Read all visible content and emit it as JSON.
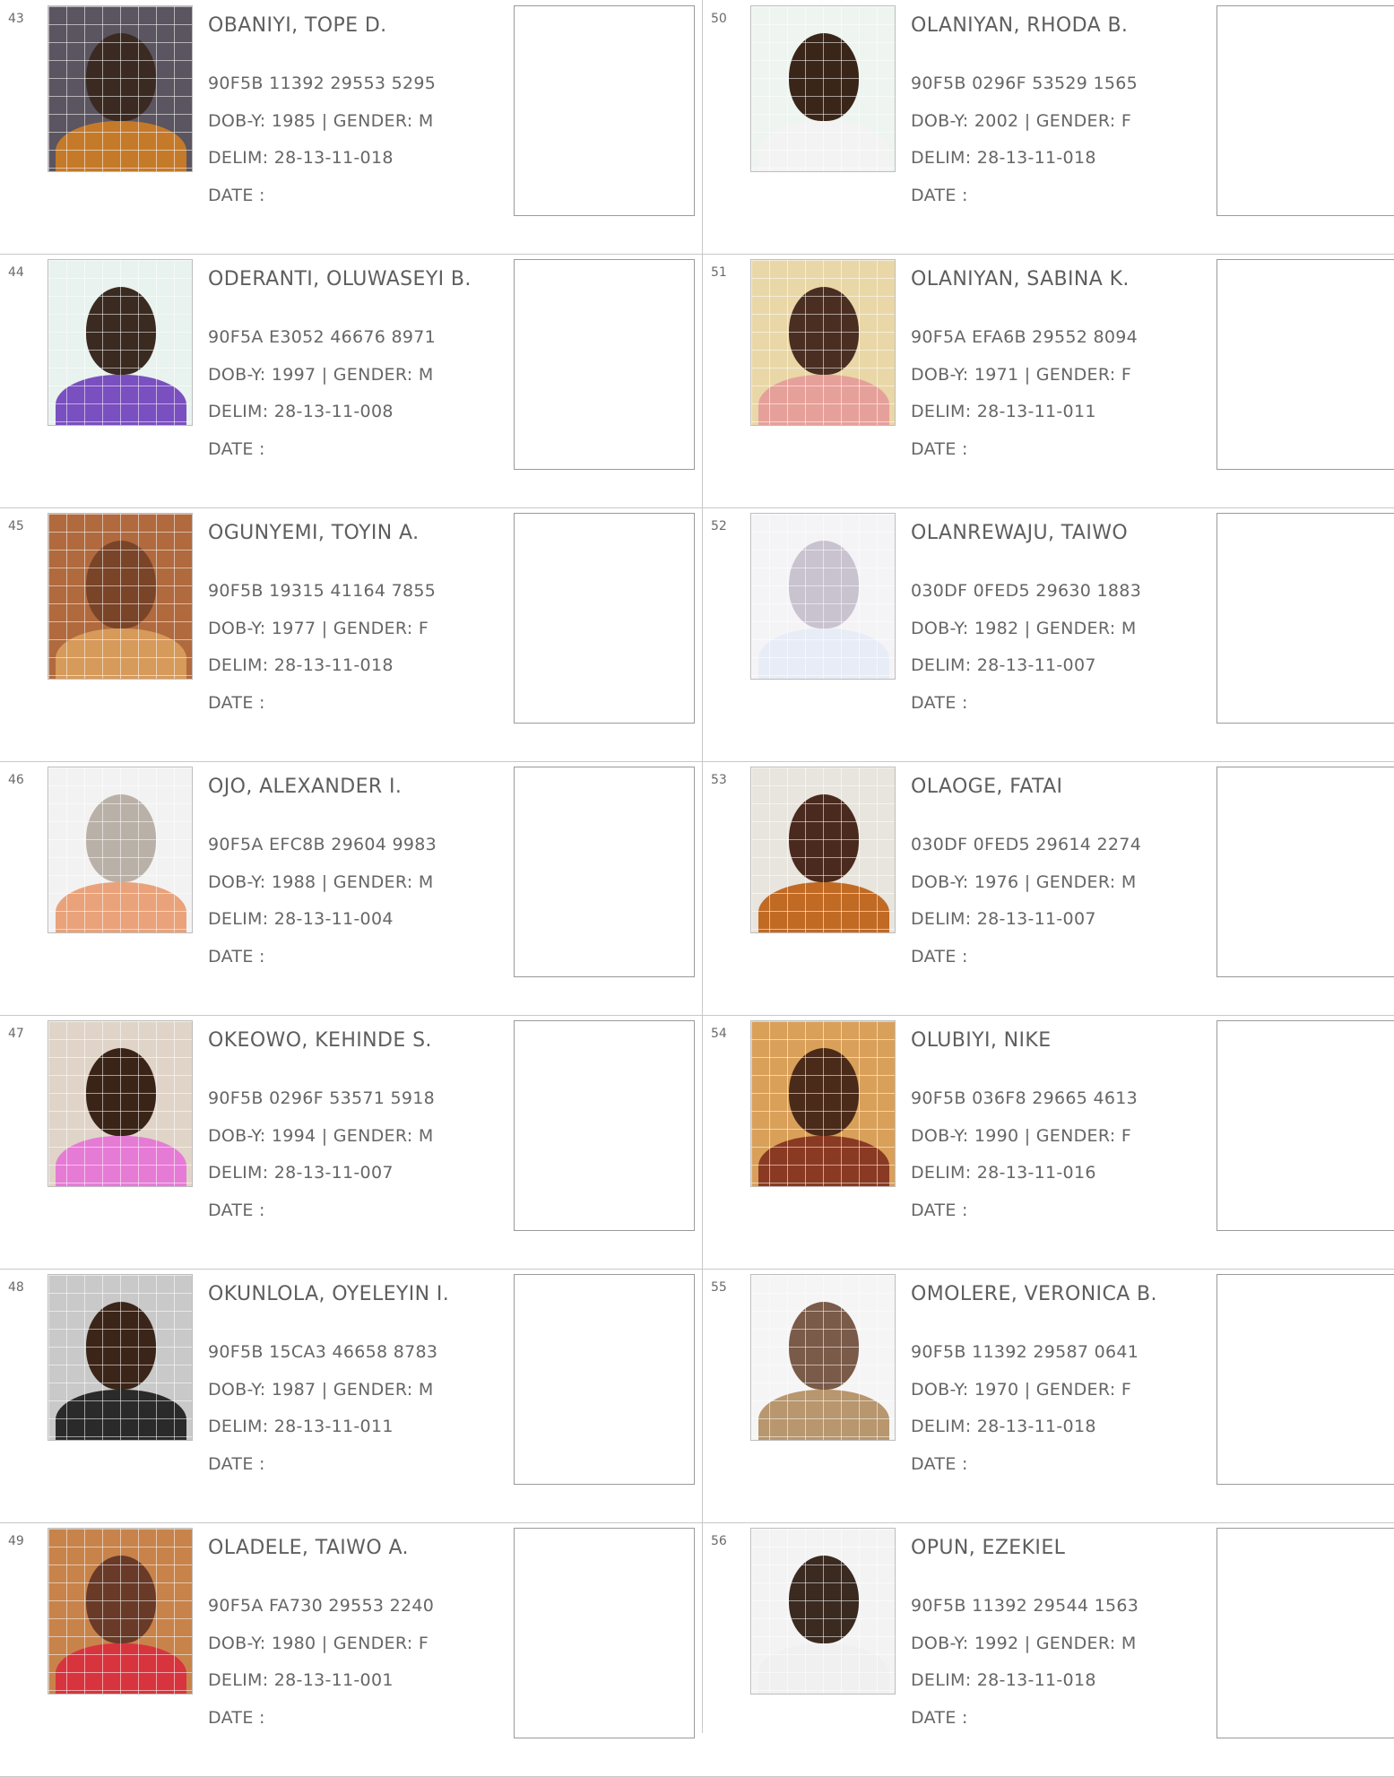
{
  "records": [
    {
      "serial": "43",
      "name": "OBANIYI, TOPE D.",
      "vin": "90F5B 11392 29553 5295",
      "dob_gender": "DOB-Y: 1985  | GENDER: M",
      "delim": "DELIM: 28-13-11-018",
      "date": "DATE  :",
      "photo": {
        "bg": "#5a5560",
        "head": "#3b2a22",
        "body": "#c57a2a"
      }
    },
    {
      "serial": "44",
      "name": "ODERANTI, OLUWASEYI B.",
      "vin": "90F5A E3052 46676 8971",
      "dob_gender": "DOB-Y: 1997  | GENDER: M",
      "delim": "DELIM: 28-13-11-008",
      "date": "DATE  :",
      "photo": {
        "bg": "#e8f2ee",
        "head": "#3a2a20",
        "body": "#7a4fbf"
      }
    },
    {
      "serial": "45",
      "name": "OGUNYEMI, TOYIN A.",
      "vin": "90F5B 19315 41164 7855",
      "dob_gender": "DOB-Y: 1977  | GENDER: F",
      "delim": "DELIM: 28-13-11-018",
      "date": "DATE  :",
      "photo": {
        "bg": "#b06a3e",
        "head": "#7a4428",
        "body": "#d69a5a"
      }
    },
    {
      "serial": "46",
      "name": "OJO, ALEXANDER I.",
      "vin": "90F5A EFC8B 29604 9983",
      "dob_gender": "DOB-Y: 1988  | GENDER: M",
      "delim": "DELIM: 28-13-11-004",
      "date": "DATE  :",
      "photo": {
        "bg": "#f2f2f2",
        "head": "#b9b0a8",
        "body": "#e9a27a"
      }
    },
    {
      "serial": "47",
      "name": "OKEOWO, KEHINDE S.",
      "vin": "90F5B 0296F 53571 5918",
      "dob_gender": "DOB-Y: 1994  | GENDER: M",
      "delim": "DELIM: 28-13-11-007",
      "date": "DATE  :",
      "photo": {
        "bg": "#e0d4c8",
        "head": "#3a2418",
        "body": "#e67bd6"
      }
    },
    {
      "serial": "48",
      "name": "OKUNLOLA, OYELEYIN I.",
      "vin": "90F5B 15CA3 46658 8783",
      "dob_gender": "DOB-Y: 1987  | GENDER: M",
      "delim": "DELIM: 28-13-11-011",
      "date": "DATE  :",
      "photo": {
        "bg": "#c9c9c9",
        "head": "#3b2518",
        "body": "#2a2a2a"
      }
    },
    {
      "serial": "49",
      "name": "OLADELE, TAIWO A.",
      "vin": "90F5A FA730 29553 2240",
      "dob_gender": "DOB-Y: 1980  | GENDER: F",
      "delim": "DELIM: 28-13-11-001",
      "date": "DATE  :",
      "photo": {
        "bg": "#c8834a",
        "head": "#6a3a28",
        "body": "#d8343e"
      }
    },
    {
      "serial": "50",
      "name": "OLANIYAN, RHODA B.",
      "vin": "90F5B 0296F 53529 1565",
      "dob_gender": "DOB-Y: 2002  | GENDER: F",
      "delim": "DELIM: 28-13-11-018",
      "date": "DATE  :",
      "photo": {
        "bg": "#eef4f0",
        "head": "#3a2618",
        "body": "#f3f3f3"
      }
    },
    {
      "serial": "51",
      "name": "OLANIYAN, SABINA K.",
      "vin": "90F5A EFA6B 29552 8094",
      "dob_gender": "DOB-Y: 1971  | GENDER: F",
      "delim": "DELIM: 28-13-11-011",
      "date": "DATE  :",
      "photo": {
        "bg": "#e9d7a8",
        "head": "#4a2e22",
        "body": "#e6a09a"
      }
    },
    {
      "serial": "52",
      "name": "OLANREWAJU, TAIWO",
      "vin": "030DF 0FED5 29630 1883",
      "dob_gender": "DOB-Y: 1982  | GENDER: M",
      "delim": "DELIM: 28-13-11-007",
      "date": "DATE  :",
      "photo": {
        "bg": "#f4f4f6",
        "head": "#c9c2cf",
        "body": "#e8ecf6"
      }
    },
    {
      "serial": "53",
      "name": "OLAOGE, FATAI",
      "vin": "030DF 0FED5 29614 2274",
      "dob_gender": "DOB-Y: 1976  | GENDER: M",
      "delim": "DELIM: 28-13-11-007",
      "date": "DATE  :",
      "photo": {
        "bg": "#e8e4de",
        "head": "#4a2a1e",
        "body": "#c06a24"
      }
    },
    {
      "serial": "54",
      "name": "OLUBIYI, NIKE",
      "vin": "90F5B 036F8 29665 4613",
      "dob_gender": "DOB-Y: 1990  | GENDER: F",
      "delim": "DELIM: 28-13-11-016",
      "date": "DATE  :",
      "photo": {
        "bg": "#d9a05a",
        "head": "#4a2a18",
        "body": "#8a3a22"
      }
    },
    {
      "serial": "55",
      "name": "OMOLERE, VERONICA B.",
      "vin": "90F5B 11392 29587 0641",
      "dob_gender": "DOB-Y: 1970  | GENDER: F",
      "delim": "DELIM: 28-13-11-018",
      "date": "DATE  :",
      "photo": {
        "bg": "#f5f5f5",
        "head": "#7a5a48",
        "body": "#b8966e"
      }
    },
    {
      "serial": "56",
      "name": "OPUN, EZEKIEL",
      "vin": "90F5B 11392 29544 1563",
      "dob_gender": "DOB-Y: 1992  | GENDER: M",
      "delim": "DELIM: 28-13-11-018",
      "date": "DATE  :",
      "photo": {
        "bg": "#f3f3f3",
        "head": "#3a2a20",
        "body": "#f0f0f0"
      }
    }
  ]
}
